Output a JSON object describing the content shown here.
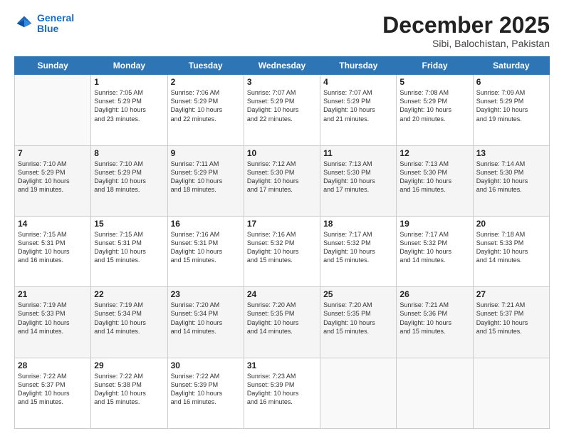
{
  "header": {
    "logo_line1": "General",
    "logo_line2": "Blue",
    "month": "December 2025",
    "location": "Sibi, Balochistan, Pakistan"
  },
  "weekdays": [
    "Sunday",
    "Monday",
    "Tuesday",
    "Wednesday",
    "Thursday",
    "Friday",
    "Saturday"
  ],
  "weeks": [
    [
      {
        "day": "",
        "info": ""
      },
      {
        "day": "1",
        "info": "Sunrise: 7:05 AM\nSunset: 5:29 PM\nDaylight: 10 hours\nand 23 minutes."
      },
      {
        "day": "2",
        "info": "Sunrise: 7:06 AM\nSunset: 5:29 PM\nDaylight: 10 hours\nand 22 minutes."
      },
      {
        "day": "3",
        "info": "Sunrise: 7:07 AM\nSunset: 5:29 PM\nDaylight: 10 hours\nand 22 minutes."
      },
      {
        "day": "4",
        "info": "Sunrise: 7:07 AM\nSunset: 5:29 PM\nDaylight: 10 hours\nand 21 minutes."
      },
      {
        "day": "5",
        "info": "Sunrise: 7:08 AM\nSunset: 5:29 PM\nDaylight: 10 hours\nand 20 minutes."
      },
      {
        "day": "6",
        "info": "Sunrise: 7:09 AM\nSunset: 5:29 PM\nDaylight: 10 hours\nand 19 minutes."
      }
    ],
    [
      {
        "day": "7",
        "info": "Sunrise: 7:10 AM\nSunset: 5:29 PM\nDaylight: 10 hours\nand 19 minutes."
      },
      {
        "day": "8",
        "info": "Sunrise: 7:10 AM\nSunset: 5:29 PM\nDaylight: 10 hours\nand 18 minutes."
      },
      {
        "day": "9",
        "info": "Sunrise: 7:11 AM\nSunset: 5:29 PM\nDaylight: 10 hours\nand 18 minutes."
      },
      {
        "day": "10",
        "info": "Sunrise: 7:12 AM\nSunset: 5:30 PM\nDaylight: 10 hours\nand 17 minutes."
      },
      {
        "day": "11",
        "info": "Sunrise: 7:13 AM\nSunset: 5:30 PM\nDaylight: 10 hours\nand 17 minutes."
      },
      {
        "day": "12",
        "info": "Sunrise: 7:13 AM\nSunset: 5:30 PM\nDaylight: 10 hours\nand 16 minutes."
      },
      {
        "day": "13",
        "info": "Sunrise: 7:14 AM\nSunset: 5:30 PM\nDaylight: 10 hours\nand 16 minutes."
      }
    ],
    [
      {
        "day": "14",
        "info": "Sunrise: 7:15 AM\nSunset: 5:31 PM\nDaylight: 10 hours\nand 16 minutes."
      },
      {
        "day": "15",
        "info": "Sunrise: 7:15 AM\nSunset: 5:31 PM\nDaylight: 10 hours\nand 15 minutes."
      },
      {
        "day": "16",
        "info": "Sunrise: 7:16 AM\nSunset: 5:31 PM\nDaylight: 10 hours\nand 15 minutes."
      },
      {
        "day": "17",
        "info": "Sunrise: 7:16 AM\nSunset: 5:32 PM\nDaylight: 10 hours\nand 15 minutes."
      },
      {
        "day": "18",
        "info": "Sunrise: 7:17 AM\nSunset: 5:32 PM\nDaylight: 10 hours\nand 15 minutes."
      },
      {
        "day": "19",
        "info": "Sunrise: 7:17 AM\nSunset: 5:32 PM\nDaylight: 10 hours\nand 14 minutes."
      },
      {
        "day": "20",
        "info": "Sunrise: 7:18 AM\nSunset: 5:33 PM\nDaylight: 10 hours\nand 14 minutes."
      }
    ],
    [
      {
        "day": "21",
        "info": "Sunrise: 7:19 AM\nSunset: 5:33 PM\nDaylight: 10 hours\nand 14 minutes."
      },
      {
        "day": "22",
        "info": "Sunrise: 7:19 AM\nSunset: 5:34 PM\nDaylight: 10 hours\nand 14 minutes."
      },
      {
        "day": "23",
        "info": "Sunrise: 7:20 AM\nSunset: 5:34 PM\nDaylight: 10 hours\nand 14 minutes."
      },
      {
        "day": "24",
        "info": "Sunrise: 7:20 AM\nSunset: 5:35 PM\nDaylight: 10 hours\nand 14 minutes."
      },
      {
        "day": "25",
        "info": "Sunrise: 7:20 AM\nSunset: 5:35 PM\nDaylight: 10 hours\nand 15 minutes."
      },
      {
        "day": "26",
        "info": "Sunrise: 7:21 AM\nSunset: 5:36 PM\nDaylight: 10 hours\nand 15 minutes."
      },
      {
        "day": "27",
        "info": "Sunrise: 7:21 AM\nSunset: 5:37 PM\nDaylight: 10 hours\nand 15 minutes."
      }
    ],
    [
      {
        "day": "28",
        "info": "Sunrise: 7:22 AM\nSunset: 5:37 PM\nDaylight: 10 hours\nand 15 minutes."
      },
      {
        "day": "29",
        "info": "Sunrise: 7:22 AM\nSunset: 5:38 PM\nDaylight: 10 hours\nand 15 minutes."
      },
      {
        "day": "30",
        "info": "Sunrise: 7:22 AM\nSunset: 5:39 PM\nDaylight: 10 hours\nand 16 minutes."
      },
      {
        "day": "31",
        "info": "Sunrise: 7:23 AM\nSunset: 5:39 PM\nDaylight: 10 hours\nand 16 minutes."
      },
      {
        "day": "",
        "info": ""
      },
      {
        "day": "",
        "info": ""
      },
      {
        "day": "",
        "info": ""
      }
    ]
  ]
}
